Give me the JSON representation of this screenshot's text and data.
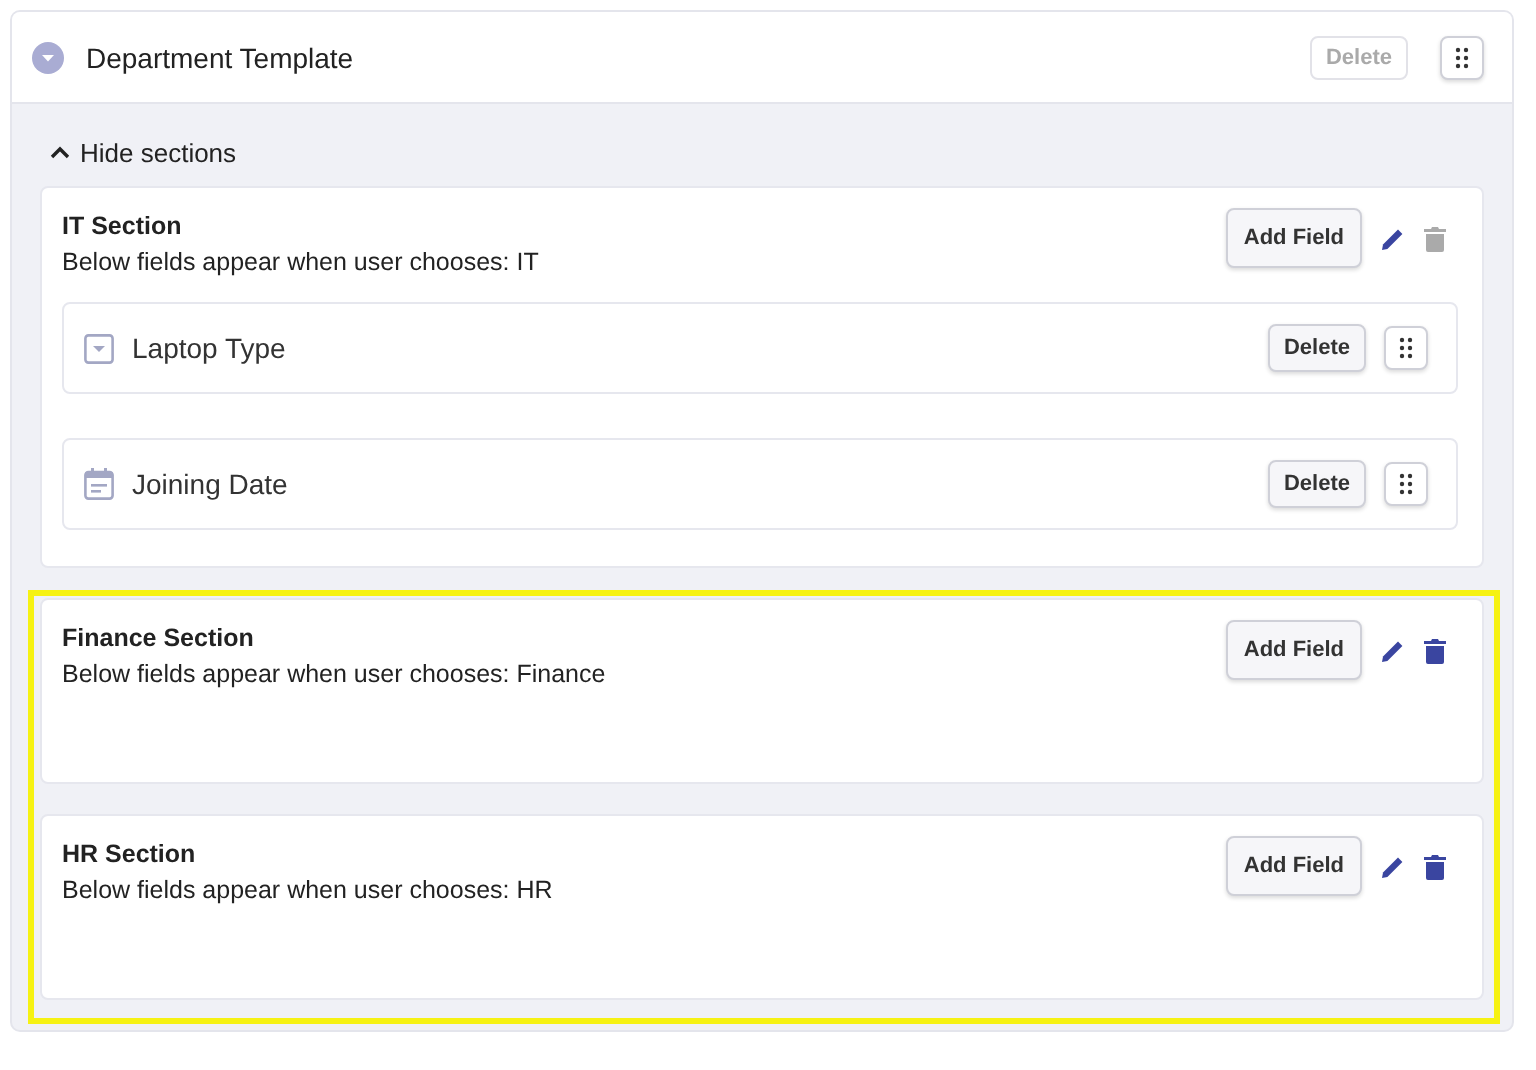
{
  "template": {
    "title": "Department Template",
    "expanded": true,
    "delete_button": {
      "label": "Delete",
      "disabled": true
    }
  },
  "toggle": {
    "label": "Hide sections",
    "expanded": true
  },
  "sections": [
    {
      "title": "IT Section",
      "subtitle": "Below fields appear when user chooses: IT",
      "add_button": "Add Field",
      "delete_disabled": true,
      "highlighted": false,
      "fields": [
        {
          "kind": "dropdown",
          "label": "Laptop Type",
          "delete_button": "Delete"
        },
        {
          "kind": "date",
          "label": "Joining Date",
          "delete_button": "Delete"
        }
      ]
    },
    {
      "title": "Finance Section",
      "subtitle": "Below fields appear when user chooses: Finance",
      "add_button": "Add Field",
      "delete_disabled": false,
      "highlighted": true
    },
    {
      "title": "HR Section",
      "subtitle": "Below fields appear when user chooses: HR",
      "add_button": "Add Field",
      "delete_disabled": false,
      "highlighted": true
    }
  ]
}
